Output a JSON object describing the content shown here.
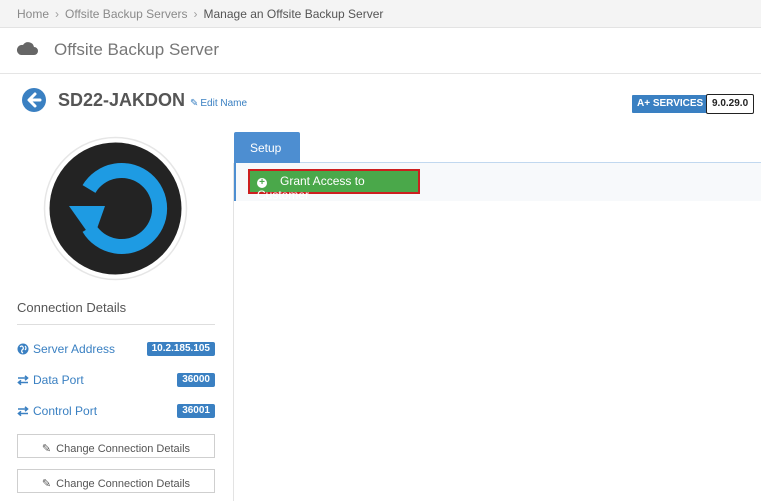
{
  "breadcrumb": {
    "items": [
      "Home",
      "Offsite Backup Servers",
      "Manage an Offsite Backup Server"
    ],
    "separator": "›"
  },
  "header": {
    "title": "Offsite Backup Server",
    "icon": "cloud-icon"
  },
  "server": {
    "name": "SD22-JAKDON",
    "edit_label": "Edit Name",
    "services_badge": "A+ SERVICES",
    "version": "9.0.29.0"
  },
  "connection": {
    "title": "Connection Details",
    "rows": [
      {
        "label": "Server Address",
        "value": "10.2.185.105",
        "icon": "globe-icon"
      },
      {
        "label": "Data Port",
        "value": "36000",
        "icon": "exchange-icon"
      },
      {
        "label": "Control Port",
        "value": "36001",
        "icon": "exchange-icon"
      }
    ],
    "buttons": [
      "Change Connection Details",
      "Change Connection Details"
    ]
  },
  "tabs": {
    "setup_label": "Setup"
  },
  "actions": {
    "grant_label": "Grant Access to Customer"
  },
  "colors": {
    "accent": "#3a80c2",
    "success": "#4aa84a",
    "highlight": "#cc1f1f"
  }
}
